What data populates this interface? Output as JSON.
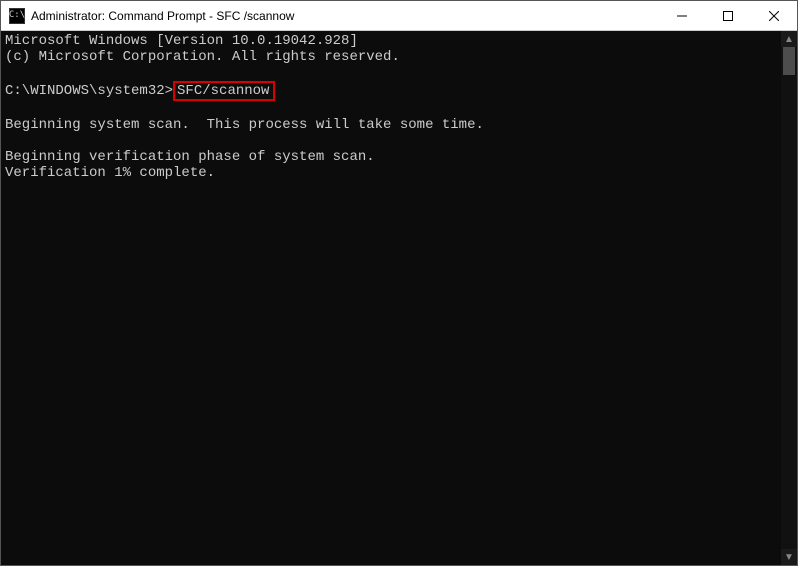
{
  "titlebar": {
    "icon_text": "C:\\",
    "title": "Administrator: Command Prompt - SFC /scannow"
  },
  "console": {
    "line1": "Microsoft Windows [Version 10.0.19042.928]",
    "line2": "(c) Microsoft Corporation. All rights reserved.",
    "blank": "",
    "prompt": "C:\\WINDOWS\\system32>",
    "command": "SFC/scannow",
    "line3": "Beginning system scan.  This process will take some time.",
    "line4": "Beginning verification phase of system scan.",
    "line5": "Verification 1% complete."
  }
}
